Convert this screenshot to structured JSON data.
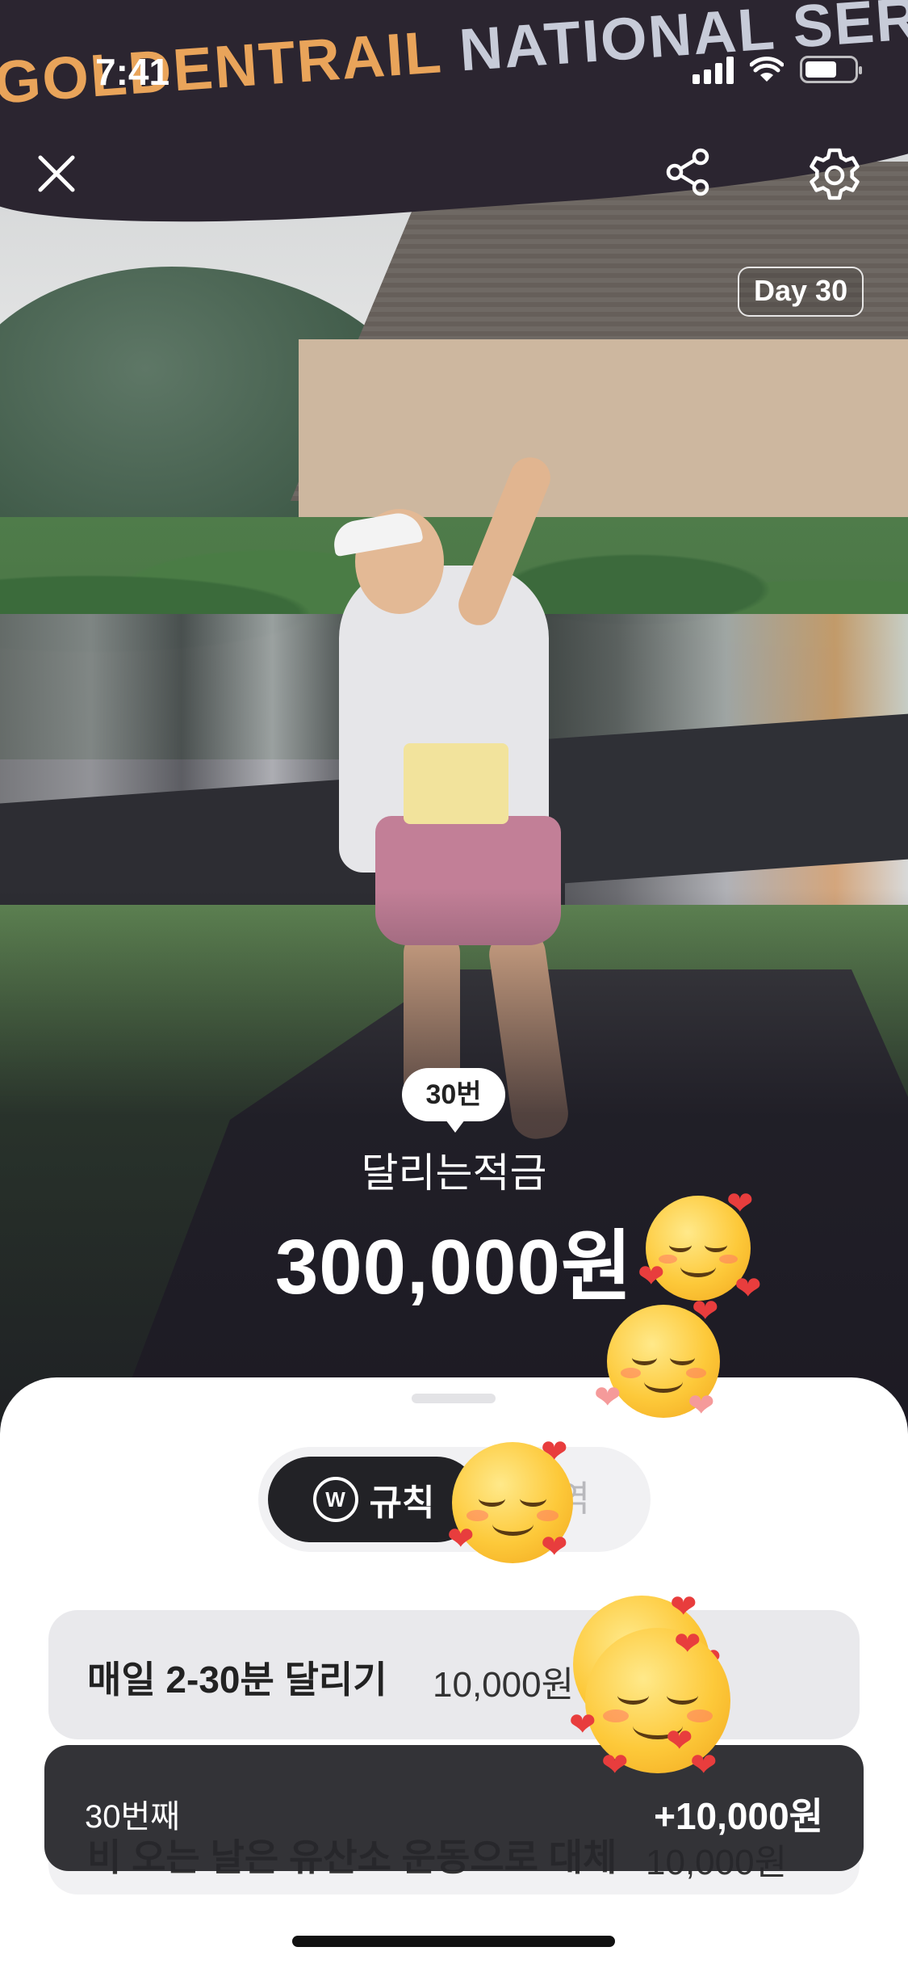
{
  "status_bar": {
    "time": "7:41"
  },
  "photo": {
    "arch_text_1": "GOLDENTRAIL",
    "arch_text_2": " NATIONAL SERIES"
  },
  "top_bar": {
    "day_badge": "Day 30"
  },
  "summary": {
    "count": "30번",
    "product_name": "달리는적금",
    "amount": "300,000원"
  },
  "tabs": {
    "rule_label": "규칙",
    "history_label": "내역",
    "active": "rule"
  },
  "rules": [
    {
      "title": "매일 2-30분 달리기",
      "amount": "10,000원"
    },
    {
      "title": "비 오는 날은 유산소 운동으로 대체",
      "amount": "10,000원"
    }
  ],
  "toast": {
    "left_text": "30번째",
    "right_text": "+10,000원"
  },
  "colors": {
    "sheet": "#ffffff",
    "active_tab": "#222226",
    "toast_bg": "#26262a",
    "emoji": "#fdc93a",
    "heart": "#e83d3d"
  },
  "icons": [
    "close-icon",
    "share-icon",
    "gear-icon",
    "won-icon",
    "smiling-face-with-hearts-emoji"
  ]
}
